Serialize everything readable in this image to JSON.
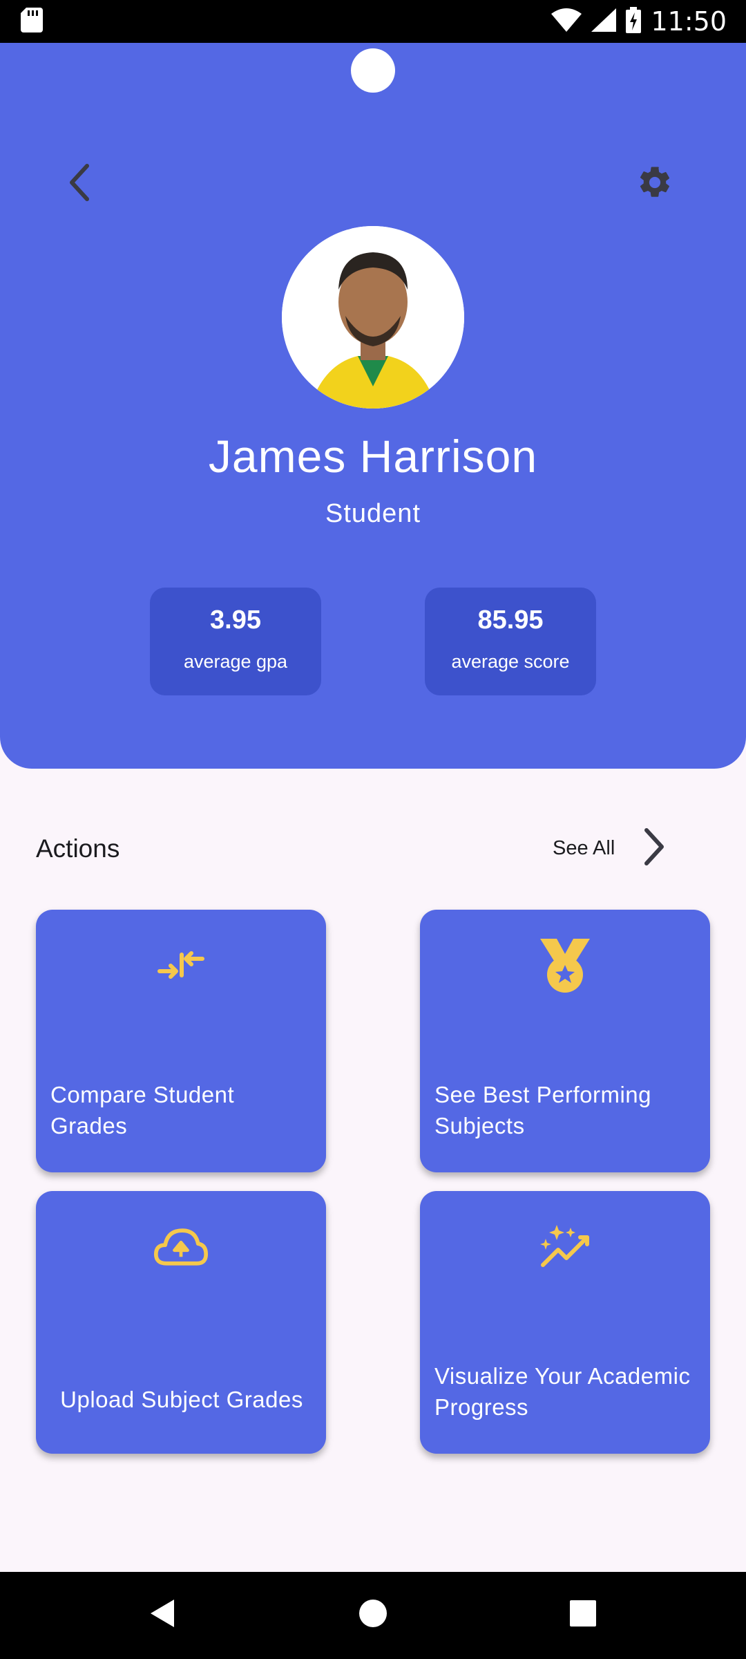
{
  "status_bar": {
    "time": "11:50",
    "icons": [
      "sd-card-icon",
      "wifi-icon",
      "signal-icon",
      "battery-charging-icon"
    ]
  },
  "header": {
    "back_icon": "chevron-left-icon",
    "settings_icon": "gear-icon",
    "avatar_alt": "Profile photo",
    "name": "James Harrison",
    "role": "Student",
    "stats": [
      {
        "value": "3.95",
        "label": "average gpa"
      },
      {
        "value": "85.95",
        "label": "average score"
      }
    ]
  },
  "actions": {
    "title": "Actions",
    "see_all_label": "See All",
    "items": [
      {
        "label": "Compare Student Grades",
        "icon": "compare-arrows-icon"
      },
      {
        "label": "See Best Performing Subjects",
        "icon": "medal-icon"
      },
      {
        "label": "Upload Subject Grades",
        "icon": "cloud-upload-icon"
      },
      {
        "label": "Visualize Your Academic Progress",
        "icon": "sparkle-chart-icon"
      }
    ]
  },
  "nav_bar": {
    "icons": [
      "nav-back-icon",
      "nav-home-icon",
      "nav-recents-icon"
    ]
  },
  "colors": {
    "primary": "#5468e4",
    "stat_card": "#3d52cc",
    "accent_icon": "#f5c84c",
    "background": "#fbf5fb",
    "text_dark": "#1b1b1f"
  }
}
